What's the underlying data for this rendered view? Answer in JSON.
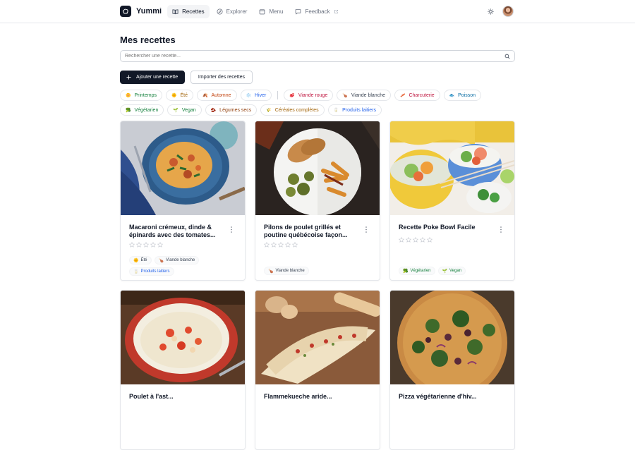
{
  "app": {
    "name": "Yummi"
  },
  "nav": [
    {
      "label": "Recettes",
      "icon": "book-icon",
      "active": true
    },
    {
      "label": "Explorer",
      "icon": "compass-icon",
      "active": false
    },
    {
      "label": "Menu",
      "icon": "calendar-icon",
      "active": false
    },
    {
      "label": "Feedback",
      "icon": "message-icon",
      "active": false
    }
  ],
  "page": {
    "title": "Mes recettes",
    "search_placeholder": "Rechercher une recette...",
    "add_label": "Ajouter une recette",
    "import_label": "Importer des recettes"
  },
  "filters": [
    {
      "label": "Printemps",
      "emoji": "🌼",
      "color": "#15803d"
    },
    {
      "label": "Été",
      "emoji": "🌞",
      "color": "#a16207"
    },
    {
      "label": "Automne",
      "emoji": "🍂",
      "color": "#c2410c"
    },
    {
      "label": "Hiver",
      "emoji": "❄️",
      "color": "#2563eb"
    },
    {
      "label": "Viande rouge",
      "emoji": "🥩",
      "color": "#be123c"
    },
    {
      "label": "Viande blanche",
      "emoji": "🍗",
      "color": "#374151"
    },
    {
      "label": "Charcuterie",
      "emoji": "🥓",
      "color": "#be123c"
    },
    {
      "label": "Poisson",
      "emoji": "🐟",
      "color": "#0369a1"
    },
    {
      "label": "Végétarien",
      "emoji": "🥦",
      "color": "#15803d"
    },
    {
      "label": "Vegan",
      "emoji": "🌱",
      "color": "#15803d"
    },
    {
      "label": "Légumes secs",
      "emoji": "🫘",
      "color": "#92400e"
    },
    {
      "label": "Céréales complètes",
      "emoji": "🌾",
      "color": "#a16207"
    },
    {
      "label": "Produits laitiers",
      "emoji": "🥛",
      "color": "#2563eb"
    }
  ],
  "recipes": [
    {
      "title": "Macaroni crémeux, dinde & épinards avec des tomates...",
      "rating": 0,
      "tags": [
        {
          "label": "Été",
          "emoji": "🌞",
          "color": "#374151"
        },
        {
          "label": "Viande blanche",
          "emoji": "🍗",
          "color": "#374151"
        },
        {
          "label": "Produits laitiers",
          "emoji": "🥛",
          "color": "#2563eb"
        }
      ]
    },
    {
      "title": "Pilons de poulet grillés et poutine québécoise façon...",
      "rating": 0,
      "tags": [
        {
          "label": "Viande blanche",
          "emoji": "🍗",
          "color": "#374151"
        }
      ]
    },
    {
      "title": "Recette Poke Bowl Facile",
      "rating": 0,
      "tags": [
        {
          "label": "Végétarien",
          "emoji": "🥦",
          "color": "#15803d"
        },
        {
          "label": "Vegan",
          "emoji": "🌱",
          "color": "#15803d"
        }
      ]
    },
    {
      "title": "Poulet à l'ast...",
      "rating": 0,
      "tags": []
    },
    {
      "title": "Flammekueche aride...",
      "rating": 0,
      "tags": []
    },
    {
      "title": "Pizza végétarienne d'hiv...",
      "rating": 0,
      "tags": []
    }
  ]
}
